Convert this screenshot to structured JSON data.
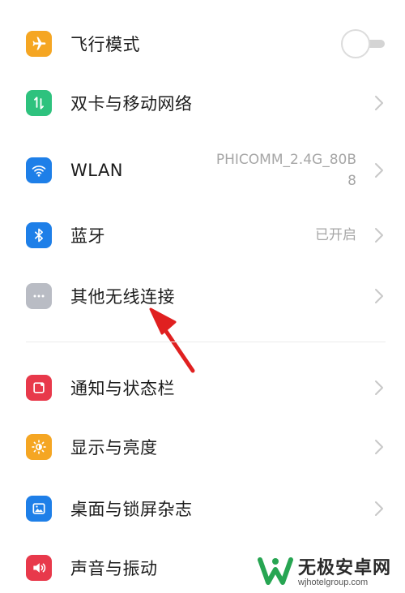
{
  "settings": {
    "airplane": {
      "label": "飞行模式",
      "icon": "airplane-icon",
      "color": "#f5a623",
      "toggle_on": false
    },
    "dual_sim": {
      "label": "双卡与移动网络",
      "icon": "dual-sim-icon",
      "color": "#2ec27e"
    },
    "wlan": {
      "label": "WLAN",
      "icon": "wifi-icon",
      "color": "#1e7fe8",
      "value_line1": "PHICOMM_2.4G_80B",
      "value_line2": "8"
    },
    "bluetooth": {
      "label": "蓝牙",
      "icon": "bluetooth-icon",
      "color": "#1e7fe8",
      "value": "已开启"
    },
    "other_wireless": {
      "label": "其他无线连接",
      "icon": "more-icon",
      "color": "#b9bcc4"
    },
    "notifications": {
      "label": "通知与状态栏",
      "icon": "notification-icon",
      "color": "#e8394b"
    },
    "display": {
      "label": "显示与亮度",
      "icon": "brightness-icon",
      "color": "#f5a623"
    },
    "desktop": {
      "label": "桌面与锁屏杂志",
      "icon": "wallpaper-icon",
      "color": "#1e7fe8"
    },
    "sound": {
      "label": "声音与振动",
      "icon": "sound-icon",
      "color": "#e8394b"
    }
  },
  "annotation": {
    "arrow_color": "#e02020"
  },
  "watermark": {
    "title": "无极安卓网",
    "url": "wjhotelgroup.com",
    "logo_color": "#27a552"
  }
}
